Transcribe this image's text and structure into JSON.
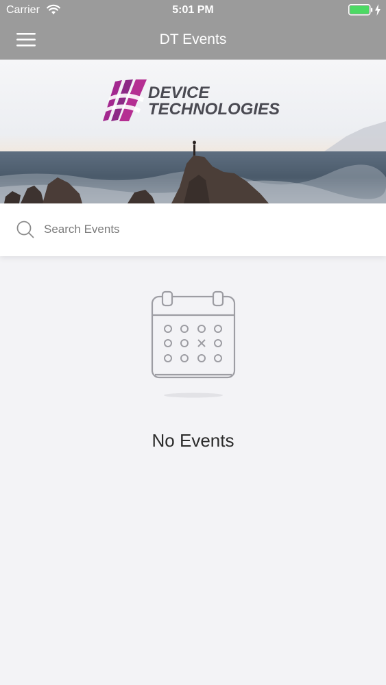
{
  "status_bar": {
    "carrier": "Carrier",
    "time": "5:01 PM",
    "battery_color": "#4cd964"
  },
  "nav_bar": {
    "title": "DT Events",
    "background": "#9b9b9b",
    "menu_icon": "hamburger-menu-icon"
  },
  "banner": {
    "logo_line1": "DEVICE",
    "logo_line2": "TECHNOLOGIES",
    "logo_accent": "#a3288f"
  },
  "search": {
    "placeholder": "Search Events",
    "value": ""
  },
  "empty_state": {
    "icon": "calendar-icon",
    "message": "No Events"
  }
}
